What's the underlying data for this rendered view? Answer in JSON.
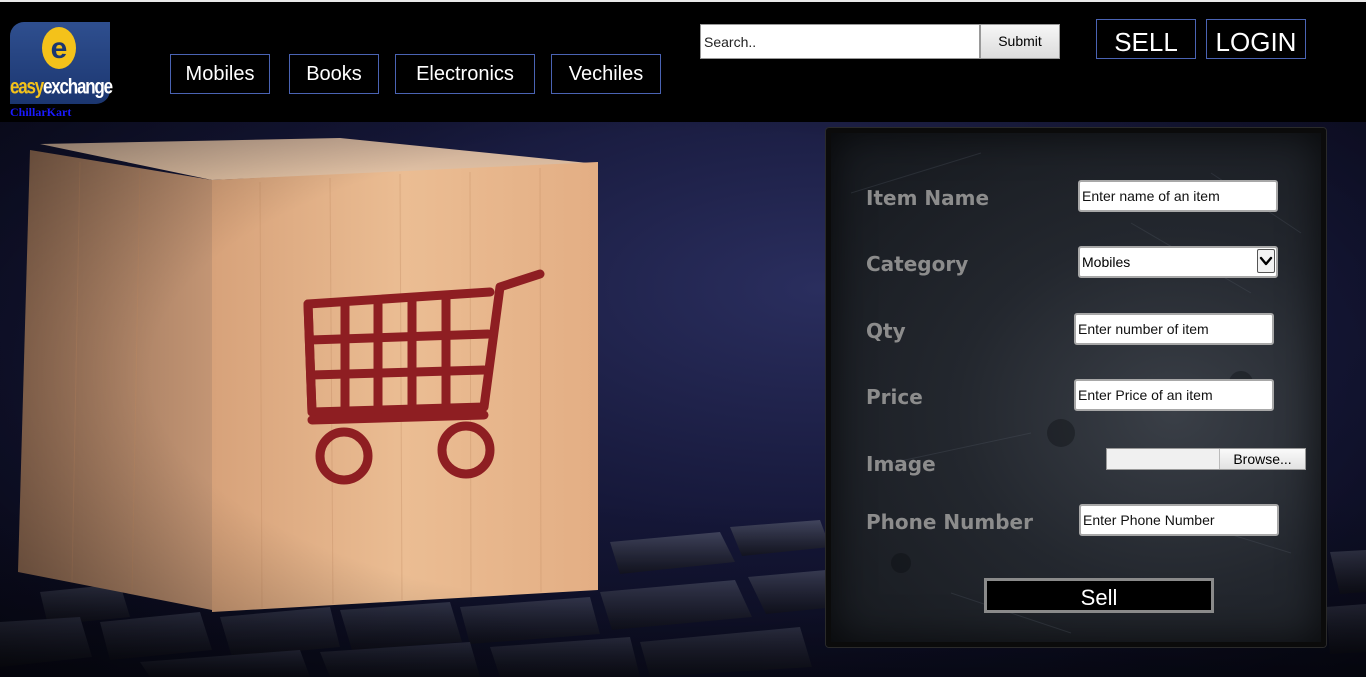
{
  "brand": {
    "logo_letter": "e",
    "word_part1": "easy",
    "word_part2": "exchange",
    "sub_label": "ChillarKart"
  },
  "nav": {
    "categories": [
      "Mobiles",
      "Books",
      "Electronics",
      "Vechiles"
    ]
  },
  "search": {
    "placeholder": "Search..",
    "submit_label": "Submit"
  },
  "top_actions": {
    "sell_label": "SELL",
    "login_label": "LOGIN"
  },
  "sell_form": {
    "item_name_label": "Item Name",
    "item_name_placeholder": "Enter name of an item",
    "category_label": "Category",
    "category_value": "Mobiles",
    "qty_label": "Qty",
    "qty_placeholder": "Enter number of item",
    "price_label": "Price",
    "price_placeholder": "Enter Price of an item",
    "image_label": "Image",
    "browse_label": "Browse...",
    "phone_label": "Phone Number",
    "phone_placeholder": "Enter Phone Number",
    "submit_label": "Sell"
  },
  "colors": {
    "header_bg": "#000000",
    "nav_border": "#4a63b3",
    "logo_bg": "#1b3670",
    "logo_yellow": "#f4c21a",
    "sub_label": "#1a1aff",
    "form_label": "#8c8c8c",
    "cart_red": "#8e1e22",
    "cube_wood": "#e6b48a"
  },
  "icons": {
    "cart": "shopping-cart-icon",
    "dropdown": "chevron-down-icon"
  }
}
